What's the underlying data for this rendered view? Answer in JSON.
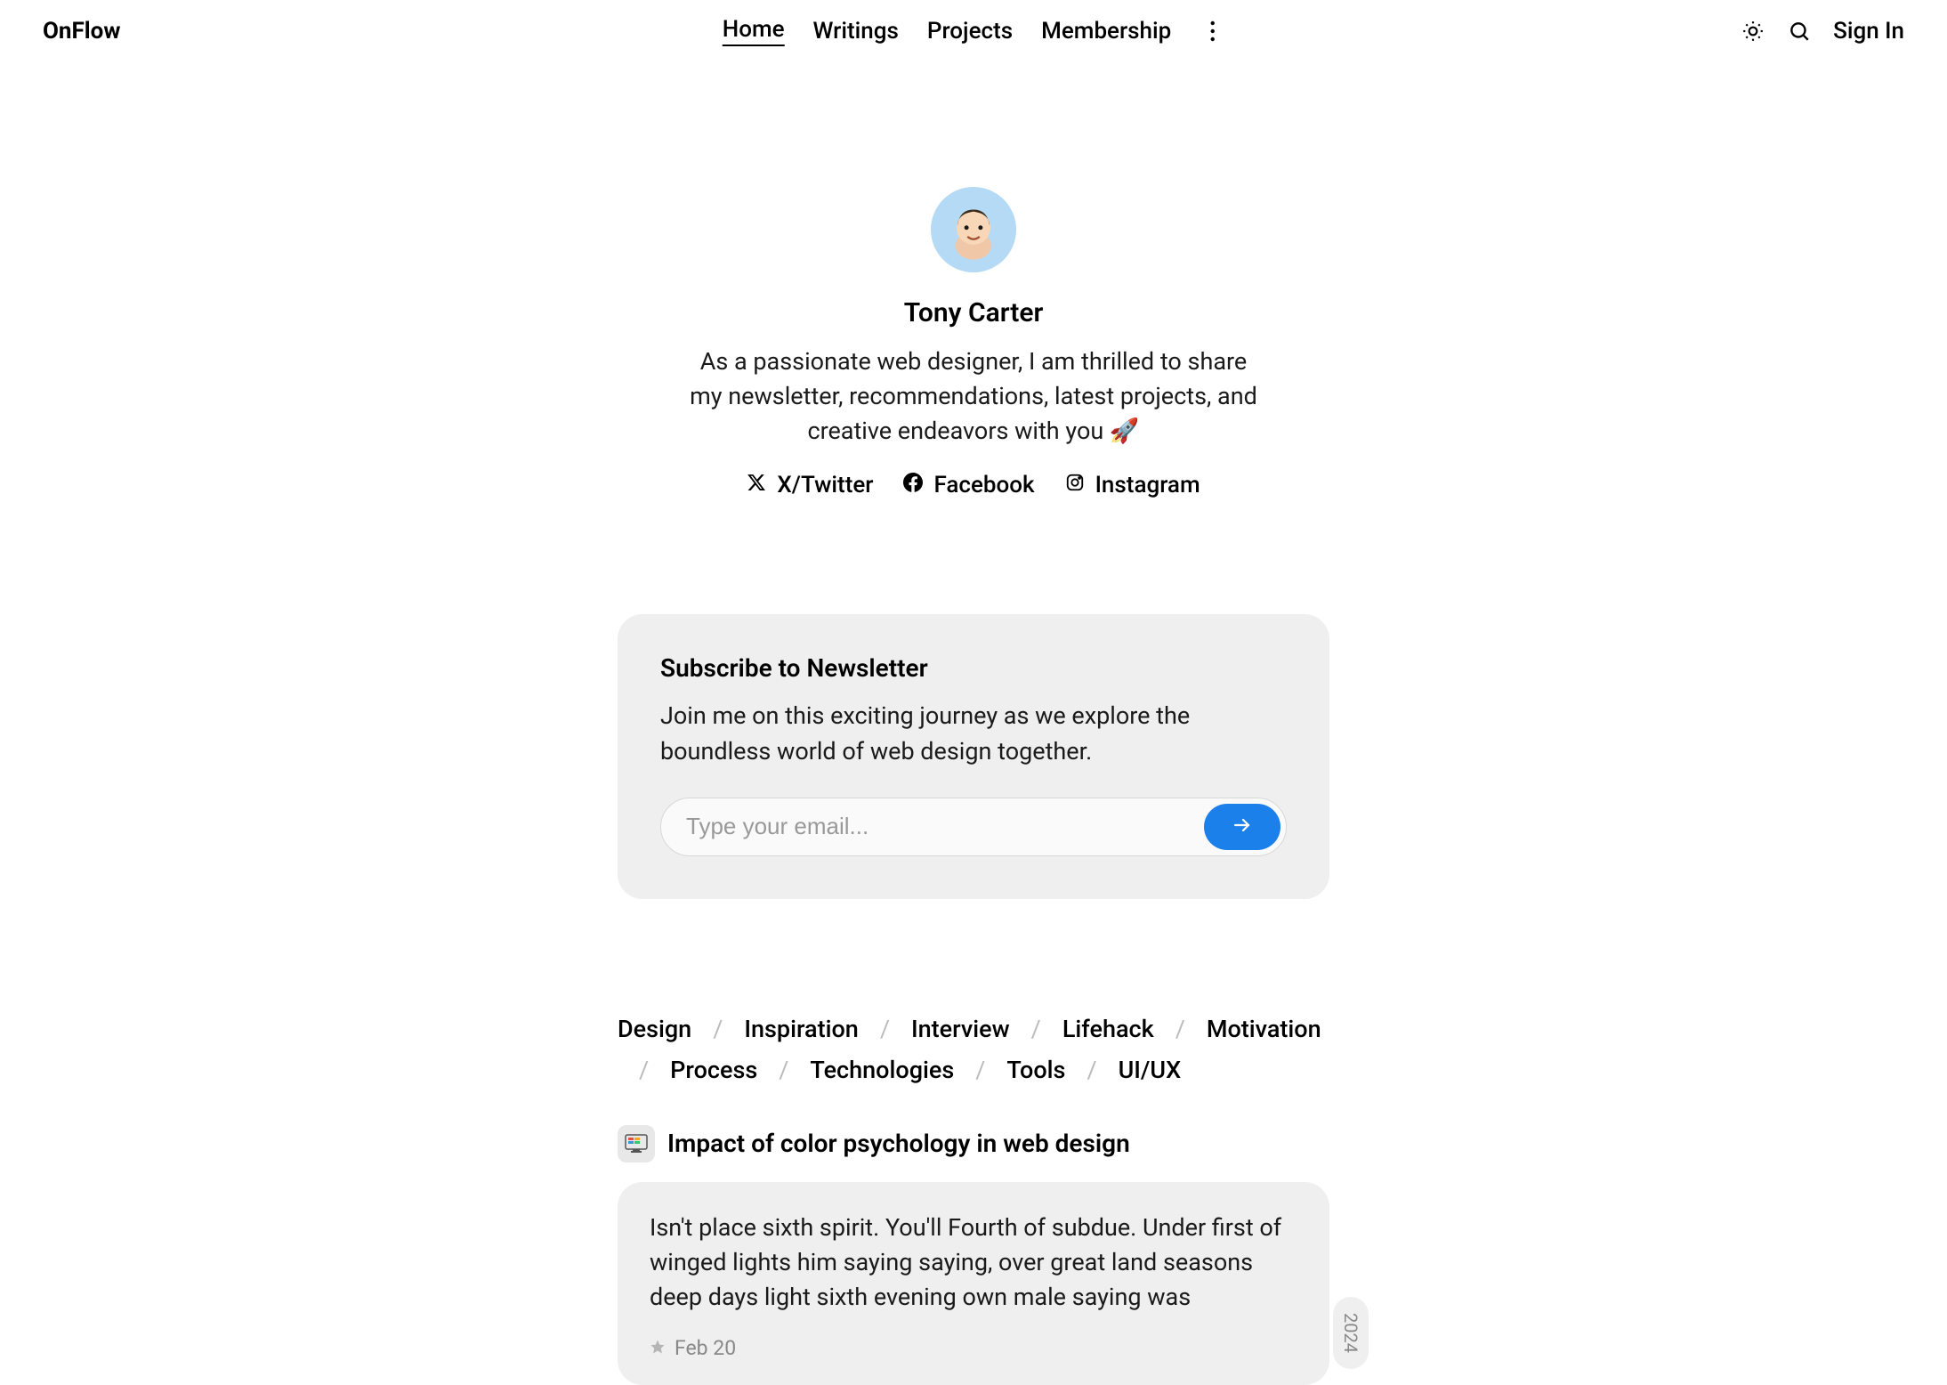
{
  "header": {
    "logo": "OnFlow",
    "nav": [
      "Home",
      "Writings",
      "Projects",
      "Membership"
    ],
    "activeIndex": 0,
    "signin": "Sign In"
  },
  "profile": {
    "name": "Tony Carter",
    "bio": "As a passionate web designer, I am thrilled to share my newsletter, recommendations, latest projects, and creative endeavors with you 🚀",
    "socials": [
      {
        "label": "X/Twitter"
      },
      {
        "label": "Facebook"
      },
      {
        "label": "Instagram"
      }
    ]
  },
  "newsletter": {
    "title": "Subscribe to Newsletter",
    "desc": "Join me on this exciting journey as we explore the boundless world of web design together.",
    "placeholder": "Type your email..."
  },
  "tags": [
    "Design",
    "Inspiration",
    "Interview",
    "Lifehack",
    "Motivation",
    "Process",
    "Technologies",
    "Tools",
    "UI/UX"
  ],
  "post": {
    "icon": "🖥️",
    "title": "Impact of color psychology in web design",
    "excerpt": "Isn't place sixth spirit. You'll Fourth of subdue. Under first of winged lights him saying saying, over great land seasons deep days light sixth evening own male saying was",
    "date": "Feb 20",
    "year": "2024"
  }
}
